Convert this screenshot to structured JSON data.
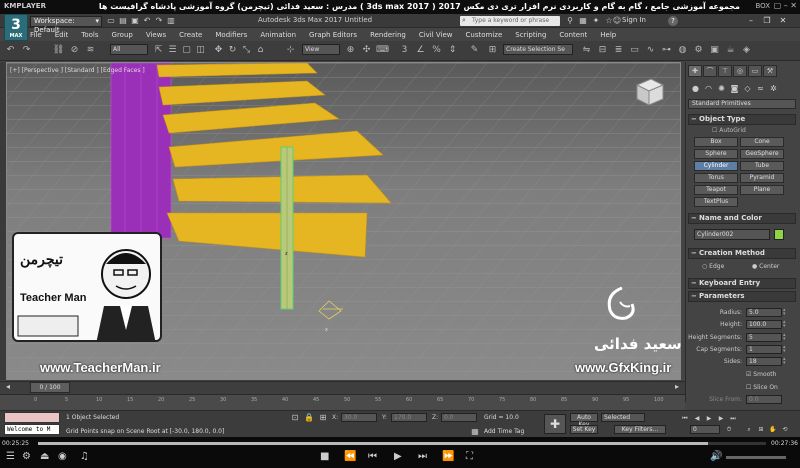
{
  "player": {
    "logo": "KMPLAYER",
    "title": "مجموعه آموزشی جامع ، گام به گام و کاربردی نرم افزار تری دی مکس 2017   ( 3ds max 2017 )   مدرس : سعید فدائی (تیچرمن) گروه آموزشی پادشاه گرافیست ها",
    "box_label": "BOX",
    "win_controls": [
      "▢",
      "–",
      "✕"
    ]
  },
  "app": {
    "logo": "3",
    "logo_sub": "MAX",
    "workspace": "Workspace: Default",
    "window_title": "Autodesk 3ds Max 2017    Untitled",
    "search_placeholder": "Type a keyword or phrase",
    "signin": "Sign In",
    "help": "?",
    "win_controls": [
      "–",
      "❐",
      "✕"
    ]
  },
  "menu": [
    "File",
    "Edit",
    "Tools",
    "Group",
    "Views",
    "Create",
    "Modifiers",
    "Animation",
    "Graph Editors",
    "Rendering",
    "Civil View",
    "Customize",
    "Scripting",
    "Content",
    "Help"
  ],
  "toolbar": {
    "filter": "All",
    "view": "View",
    "selection_set": "Create Selection Se"
  },
  "viewport": {
    "label": "[+] [Perspective ] [Standard ] [Edged Faces ]"
  },
  "overlay": {
    "teacher_logo": "تیچرمن",
    "teacher_name": "Teacher Man",
    "teacher_site": "www.TeacherMan.ir",
    "gfx_name": "سعید فدائی",
    "gfx_site": "www.GfxKing.ir"
  },
  "command_panel": {
    "primitive_type": "Standard Primitives",
    "object_type_header": "Object Type",
    "autogrid": "AutoGrid",
    "objects": [
      "Box",
      "Cone",
      "Sphere",
      "GeoSphere",
      "Cylinder",
      "Tube",
      "Torus",
      "Pyramid",
      "Teapot",
      "Plane",
      "TextPlus"
    ],
    "active_object": "Cylinder",
    "name_color_header": "Name and Color",
    "object_name": "Cylinder002",
    "object_color": "#8ed444",
    "creation_method_header": "Creation Method",
    "creation_methods": [
      "Edge",
      "Center"
    ],
    "selected_creation_method": "Center",
    "keyboard_entry_header": "Keyboard Entry",
    "parameters_header": "Parameters",
    "params": [
      {
        "label": "Radius:",
        "value": "5.0"
      },
      {
        "label": "Height:",
        "value": "100.0"
      },
      {
        "label": "Height Segments:",
        "value": "5"
      },
      {
        "label": "Cap Segments:",
        "value": "1"
      },
      {
        "label": "Sides:",
        "value": "18"
      }
    ],
    "smooth_label": "Smooth",
    "slice_on_label": "Slice On",
    "slice_from_label": "Slice From:",
    "slice_from_value": "0.0"
  },
  "timeline": {
    "position": "0 / 100",
    "ticks": [
      "0",
      "5",
      "10",
      "15",
      "20",
      "25",
      "30",
      "35",
      "40",
      "45",
      "50",
      "55",
      "60",
      "65",
      "70",
      "75",
      "80",
      "85",
      "90",
      "95",
      "100"
    ]
  },
  "status": {
    "maxscript": "Welcome to M",
    "selection": "1 Object Selected",
    "prompt": "Grid Points snap on Scene Root at [-30.0, 180.0, 0.0]",
    "x_label": "X:",
    "x": "30.0",
    "y_label": "Y:",
    "y": "170.0",
    "z_label": "Z:",
    "z": "0.0",
    "grid": "Grid = 10.0",
    "add_time_tag": "Add Time Tag",
    "auto_key": "Auto Key",
    "set_key": "Set Key",
    "selected_dd": "Selected",
    "key_filters": "Key Filters...",
    "frame": "0"
  },
  "playback": {
    "elapsed": "00:25:25",
    "total": "00:27:36",
    "progress": 0.92
  }
}
